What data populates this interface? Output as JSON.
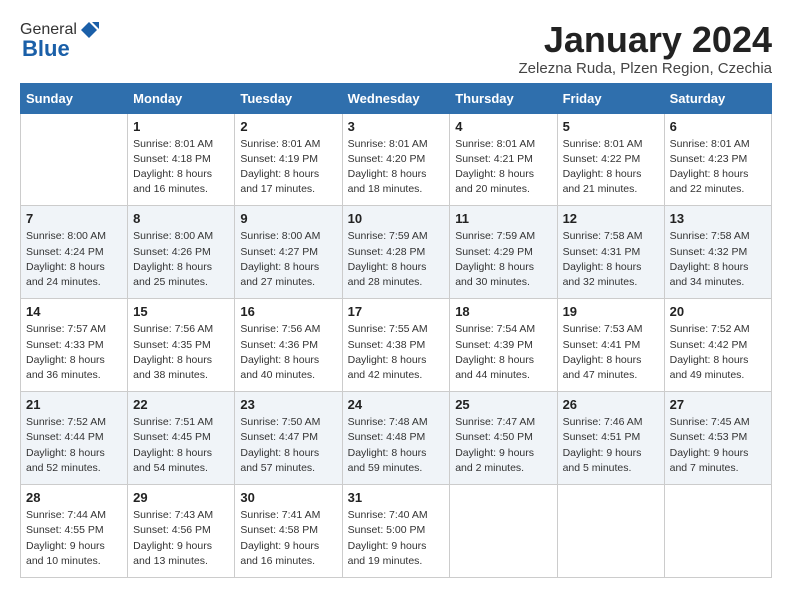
{
  "header": {
    "logo_general": "General",
    "logo_blue": "Blue",
    "month_title": "January 2024",
    "subtitle": "Zelezna Ruda, Plzen Region, Czechia"
  },
  "weekdays": [
    "Sunday",
    "Monday",
    "Tuesday",
    "Wednesday",
    "Thursday",
    "Friday",
    "Saturday"
  ],
  "weeks": [
    [
      {
        "day": "",
        "sunrise": "",
        "sunset": "",
        "daylight": ""
      },
      {
        "day": "1",
        "sunrise": "Sunrise: 8:01 AM",
        "sunset": "Sunset: 4:18 PM",
        "daylight": "Daylight: 8 hours and 16 minutes."
      },
      {
        "day": "2",
        "sunrise": "Sunrise: 8:01 AM",
        "sunset": "Sunset: 4:19 PM",
        "daylight": "Daylight: 8 hours and 17 minutes."
      },
      {
        "day": "3",
        "sunrise": "Sunrise: 8:01 AM",
        "sunset": "Sunset: 4:20 PM",
        "daylight": "Daylight: 8 hours and 18 minutes."
      },
      {
        "day": "4",
        "sunrise": "Sunrise: 8:01 AM",
        "sunset": "Sunset: 4:21 PM",
        "daylight": "Daylight: 8 hours and 20 minutes."
      },
      {
        "day": "5",
        "sunrise": "Sunrise: 8:01 AM",
        "sunset": "Sunset: 4:22 PM",
        "daylight": "Daylight: 8 hours and 21 minutes."
      },
      {
        "day": "6",
        "sunrise": "Sunrise: 8:01 AM",
        "sunset": "Sunset: 4:23 PM",
        "daylight": "Daylight: 8 hours and 22 minutes."
      }
    ],
    [
      {
        "day": "7",
        "sunrise": "Sunrise: 8:00 AM",
        "sunset": "Sunset: 4:24 PM",
        "daylight": "Daylight: 8 hours and 24 minutes."
      },
      {
        "day": "8",
        "sunrise": "Sunrise: 8:00 AM",
        "sunset": "Sunset: 4:26 PM",
        "daylight": "Daylight: 8 hours and 25 minutes."
      },
      {
        "day": "9",
        "sunrise": "Sunrise: 8:00 AM",
        "sunset": "Sunset: 4:27 PM",
        "daylight": "Daylight: 8 hours and 27 minutes."
      },
      {
        "day": "10",
        "sunrise": "Sunrise: 7:59 AM",
        "sunset": "Sunset: 4:28 PM",
        "daylight": "Daylight: 8 hours and 28 minutes."
      },
      {
        "day": "11",
        "sunrise": "Sunrise: 7:59 AM",
        "sunset": "Sunset: 4:29 PM",
        "daylight": "Daylight: 8 hours and 30 minutes."
      },
      {
        "day": "12",
        "sunrise": "Sunrise: 7:58 AM",
        "sunset": "Sunset: 4:31 PM",
        "daylight": "Daylight: 8 hours and 32 minutes."
      },
      {
        "day": "13",
        "sunrise": "Sunrise: 7:58 AM",
        "sunset": "Sunset: 4:32 PM",
        "daylight": "Daylight: 8 hours and 34 minutes."
      }
    ],
    [
      {
        "day": "14",
        "sunrise": "Sunrise: 7:57 AM",
        "sunset": "Sunset: 4:33 PM",
        "daylight": "Daylight: 8 hours and 36 minutes."
      },
      {
        "day": "15",
        "sunrise": "Sunrise: 7:56 AM",
        "sunset": "Sunset: 4:35 PM",
        "daylight": "Daylight: 8 hours and 38 minutes."
      },
      {
        "day": "16",
        "sunrise": "Sunrise: 7:56 AM",
        "sunset": "Sunset: 4:36 PM",
        "daylight": "Daylight: 8 hours and 40 minutes."
      },
      {
        "day": "17",
        "sunrise": "Sunrise: 7:55 AM",
        "sunset": "Sunset: 4:38 PM",
        "daylight": "Daylight: 8 hours and 42 minutes."
      },
      {
        "day": "18",
        "sunrise": "Sunrise: 7:54 AM",
        "sunset": "Sunset: 4:39 PM",
        "daylight": "Daylight: 8 hours and 44 minutes."
      },
      {
        "day": "19",
        "sunrise": "Sunrise: 7:53 AM",
        "sunset": "Sunset: 4:41 PM",
        "daylight": "Daylight: 8 hours and 47 minutes."
      },
      {
        "day": "20",
        "sunrise": "Sunrise: 7:52 AM",
        "sunset": "Sunset: 4:42 PM",
        "daylight": "Daylight: 8 hours and 49 minutes."
      }
    ],
    [
      {
        "day": "21",
        "sunrise": "Sunrise: 7:52 AM",
        "sunset": "Sunset: 4:44 PM",
        "daylight": "Daylight: 8 hours and 52 minutes."
      },
      {
        "day": "22",
        "sunrise": "Sunrise: 7:51 AM",
        "sunset": "Sunset: 4:45 PM",
        "daylight": "Daylight: 8 hours and 54 minutes."
      },
      {
        "day": "23",
        "sunrise": "Sunrise: 7:50 AM",
        "sunset": "Sunset: 4:47 PM",
        "daylight": "Daylight: 8 hours and 57 minutes."
      },
      {
        "day": "24",
        "sunrise": "Sunrise: 7:48 AM",
        "sunset": "Sunset: 4:48 PM",
        "daylight": "Daylight: 8 hours and 59 minutes."
      },
      {
        "day": "25",
        "sunrise": "Sunrise: 7:47 AM",
        "sunset": "Sunset: 4:50 PM",
        "daylight": "Daylight: 9 hours and 2 minutes."
      },
      {
        "day": "26",
        "sunrise": "Sunrise: 7:46 AM",
        "sunset": "Sunset: 4:51 PM",
        "daylight": "Daylight: 9 hours and 5 minutes."
      },
      {
        "day": "27",
        "sunrise": "Sunrise: 7:45 AM",
        "sunset": "Sunset: 4:53 PM",
        "daylight": "Daylight: 9 hours and 7 minutes."
      }
    ],
    [
      {
        "day": "28",
        "sunrise": "Sunrise: 7:44 AM",
        "sunset": "Sunset: 4:55 PM",
        "daylight": "Daylight: 9 hours and 10 minutes."
      },
      {
        "day": "29",
        "sunrise": "Sunrise: 7:43 AM",
        "sunset": "Sunset: 4:56 PM",
        "daylight": "Daylight: 9 hours and 13 minutes."
      },
      {
        "day": "30",
        "sunrise": "Sunrise: 7:41 AM",
        "sunset": "Sunset: 4:58 PM",
        "daylight": "Daylight: 9 hours and 16 minutes."
      },
      {
        "day": "31",
        "sunrise": "Sunrise: 7:40 AM",
        "sunset": "Sunset: 5:00 PM",
        "daylight": "Daylight: 9 hours and 19 minutes."
      },
      {
        "day": "",
        "sunrise": "",
        "sunset": "",
        "daylight": ""
      },
      {
        "day": "",
        "sunrise": "",
        "sunset": "",
        "daylight": ""
      },
      {
        "day": "",
        "sunrise": "",
        "sunset": "",
        "daylight": ""
      }
    ]
  ]
}
